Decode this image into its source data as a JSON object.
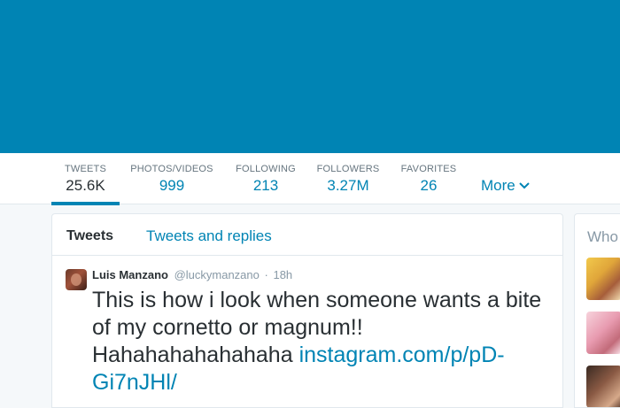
{
  "colors": {
    "header_banner": "#0084b4",
    "accent": "#0084b4",
    "text": "#292f33",
    "muted": "#66757f"
  },
  "nav": {
    "stats": [
      {
        "label": "TWEETS",
        "value": "25.6K",
        "active": true
      },
      {
        "label": "PHOTOS/VIDEOS",
        "value": "999"
      },
      {
        "label": "FOLLOWING",
        "value": "213"
      },
      {
        "label": "FOLLOWERS",
        "value": "3.27M"
      },
      {
        "label": "FAVORITES",
        "value": "26"
      }
    ],
    "more_label": "More",
    "more_icon": "chevron-down-icon"
  },
  "timeline": {
    "tabs": [
      {
        "label": "Tweets",
        "active": true
      },
      {
        "label": "Tweets and replies",
        "active": false
      }
    ],
    "tweet": {
      "fullname": "Luis Manzano",
      "username": "@luckymanzano",
      "separator": "·",
      "time": "18h",
      "text": "This is how i look when someone wants a bite of my cornetto or magnum!! Hahahahahahahaha ",
      "link": "instagram.com/p/pD-Gi7nJHl/"
    }
  },
  "sidebar": {
    "who_to_follow_label": "Who"
  }
}
